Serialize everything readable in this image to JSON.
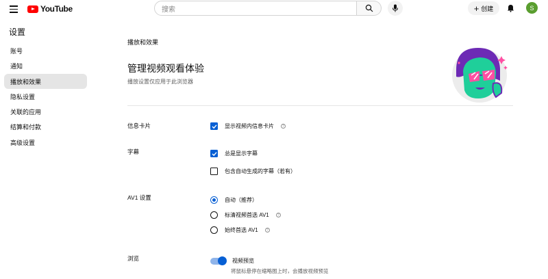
{
  "header": {
    "logo_text": "YouTube",
    "search_placeholder": "搜索",
    "create_label": "创建",
    "avatar_letter": "S"
  },
  "sidebar": {
    "title": "设置",
    "items": [
      {
        "label": "账号"
      },
      {
        "label": "通知"
      },
      {
        "label": "播放和效果",
        "active": true
      },
      {
        "label": "隐私设置"
      },
      {
        "label": "关联的应用"
      },
      {
        "label": "结算和付款"
      },
      {
        "label": "高级设置"
      }
    ]
  },
  "main": {
    "breadcrumb": "播放和效果",
    "title": "管理视频观看体验",
    "subtitle": "播放设置仅应用于此浏览器",
    "info_cards": {
      "label": "信息卡片",
      "option": "显示视频内信息卡片",
      "checked": true
    },
    "captions": {
      "label": "字幕",
      "options": [
        {
          "text": "总是显示字幕",
          "checked": true
        },
        {
          "text": "包含自动生成的字幕（若有）",
          "checked": false
        }
      ]
    },
    "av1": {
      "label": "AV1 设置",
      "options": [
        {
          "text": "自动（推荐）",
          "selected": true
        },
        {
          "text": "标清视频首选 AV1",
          "selected": false
        },
        {
          "text": "始终首选 AV1",
          "selected": false
        }
      ]
    },
    "browse": {
      "label": "浏览",
      "toggle_label": "视频预览",
      "toggle_desc": "将鼠标悬停在缩略图上时，会播放视频预览",
      "enabled": true
    }
  },
  "colors": {
    "accent": "#065fd4",
    "youtube_red": "#ff0000",
    "avatar_bg": "#5a9e2f",
    "active_item_bg": "#e5e5e5"
  },
  "icons": [
    "menu-icon",
    "youtube-logo-icon",
    "search-icon",
    "mic-icon",
    "plus-icon",
    "bell-icon",
    "help-icon"
  ]
}
